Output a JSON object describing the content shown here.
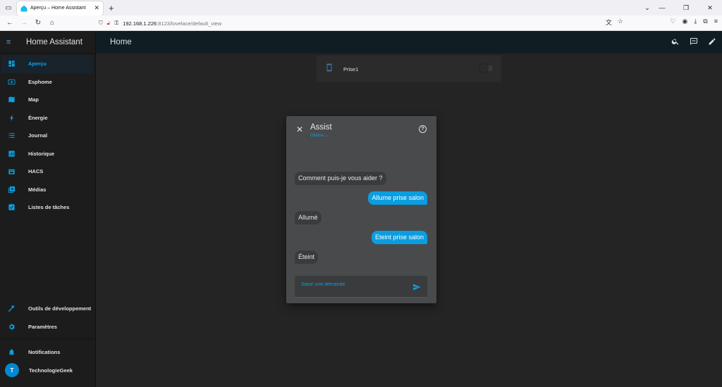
{
  "browser": {
    "tab_title": "Aperçu – Home Assistant",
    "url_host": "192.168.1.226",
    "url_path": ":8123/lovelace/default_view"
  },
  "sidebar": {
    "title": "Home Assistant",
    "items": [
      {
        "label": "Aperçu",
        "icon": "dashboard-icon",
        "active": true
      },
      {
        "label": "Esphome",
        "icon": "esphome-icon"
      },
      {
        "label": "Map",
        "icon": "map-icon"
      },
      {
        "label": "Énergie",
        "icon": "lightning-icon"
      },
      {
        "label": "Journal",
        "icon": "list-icon"
      },
      {
        "label": "Historique",
        "icon": "chart-icon"
      },
      {
        "label": "HACS",
        "icon": "hacs-icon"
      },
      {
        "label": "Médias",
        "icon": "media-icon"
      },
      {
        "label": "Listes de tâches",
        "icon": "clipboard-icon"
      }
    ],
    "dev_tools": "Outils de développement",
    "settings": "Paramètres",
    "notifications": "Notifications",
    "user_name": "TechnologieGeek",
    "user_initial": "T"
  },
  "header": {
    "title": "Home"
  },
  "card": {
    "entity_name": "Prise1",
    "state": "off"
  },
  "assist": {
    "title": "Assist",
    "pipeline": "Ollama",
    "messages": [
      {
        "from": "agent",
        "text": "Comment puis-je vous aider ?"
      },
      {
        "from": "user",
        "text": "Allume prise salon"
      },
      {
        "from": "agent",
        "text": "Allumé"
      },
      {
        "from": "user",
        "text": "Eteint prise salon"
      },
      {
        "from": "agent",
        "text": "Éteint"
      }
    ],
    "input_placeholder": "Saisir une demande"
  },
  "colors": {
    "accent": "#0a9ee0",
    "sidebar_bg": "#1c1c1c",
    "main_bg": "#242424",
    "dialog_bg": "#494a4c"
  }
}
